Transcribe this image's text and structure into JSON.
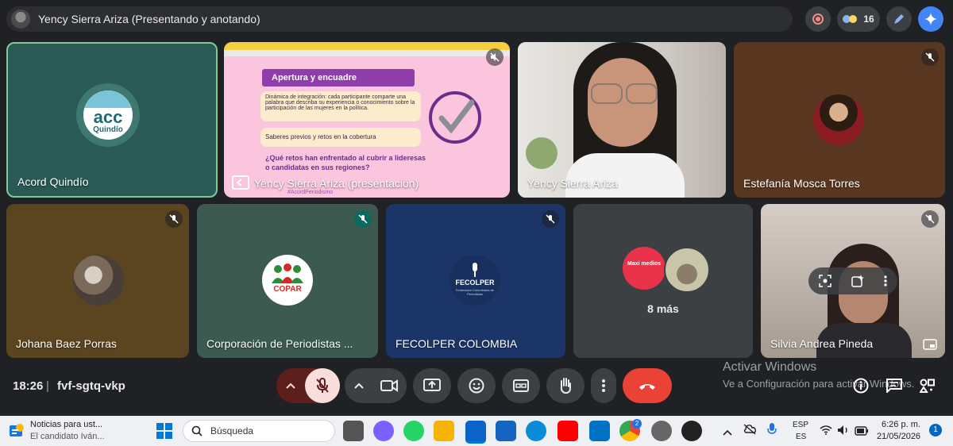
{
  "top_bar": {
    "presenter_label": "Yency Sierra Ariza (Presentando y anotando)",
    "participant_count": "16"
  },
  "tiles": {
    "acord": {
      "name": "Acord Quindío",
      "logo_text_top": "acc",
      "logo_text_bottom": "Quindío"
    },
    "presentation": {
      "name": "Yency Sierra Ariza (presentación)",
      "slide_heading": "Apertura y encuadre",
      "slide_box1": "Dinámica de integración: cada participante comparte una palabra que describa su experiencia o conocimiento sobre la participación de las mujeres en la política.",
      "slide_box2": "Saberes previos y retos en la cobertura",
      "slide_question": "¿Qué retos han enfrentado al cubrir a lideresas o candidatas en sus regiones?",
      "slide_hashtag": "#AcordPeriodismo"
    },
    "yency": {
      "name": "Yency Sierra Ariza"
    },
    "estefania": {
      "name": "Estefanía Mosca Torres"
    },
    "johana": {
      "name": "Johana Baez Porras"
    },
    "corporacion": {
      "name": "Corporación de Periodistas ...",
      "logo_text": "COPAR"
    },
    "fecolper": {
      "name": "FECOLPER COLOMBIA",
      "logo_text": "FECOLPER",
      "logo_sub": "Federación Colombiana de Periodistas"
    },
    "more": {
      "label": "8 más",
      "avatar_text": "Maxi medios"
    },
    "silvia": {
      "name": "Silvia Andrea Pineda"
    }
  },
  "bottom_bar": {
    "time": "18:26",
    "meeting_code": "fvf-sgtq-vkp"
  },
  "watermark": {
    "title": "Activar Windows",
    "subtitle": "Ve a Configuración para activar Windows."
  },
  "taskbar": {
    "news_title": "Noticias para ust...",
    "news_sub": "El candidato Iván...",
    "search_placeholder": "Búsqueda",
    "lang_top": "ESP",
    "lang_bottom": "ES",
    "clock_time": "6:26 p. m.",
    "clock_date": "21/05/2026",
    "notification_count": "1",
    "chrome_badge": "2"
  },
  "colors": {
    "accent_blue": "#8ab4f8",
    "leave_red": "#ea4335",
    "mic_off_bg": "#f9dedc",
    "active_border": "#81c995"
  }
}
